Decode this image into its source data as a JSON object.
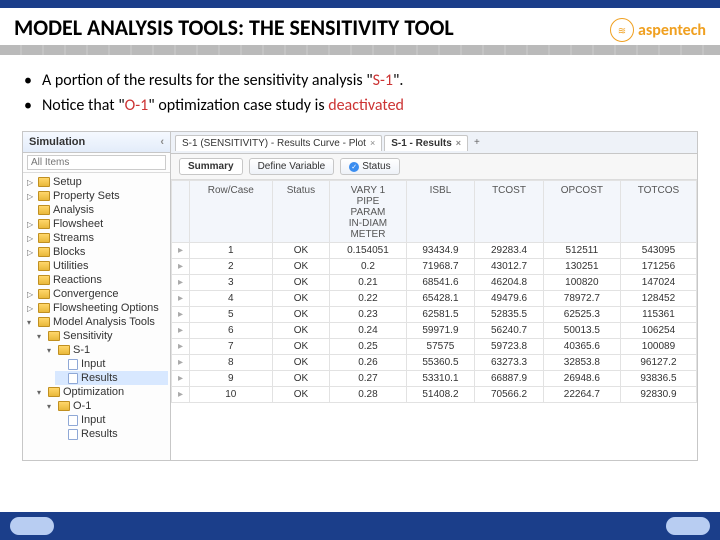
{
  "title": "MODEL ANALYSIS TOOLS: THE SENSITIVITY TOOL",
  "brand": "aspentech",
  "bullets": {
    "b1a": "A portion of the results for the sensitivity analysis \"",
    "b1b": "S-1",
    "b1c": "\".",
    "b2a": "Notice that \"",
    "b2b": "O-1",
    "b2c": "\" optimization case study is ",
    "b2d": "deactivated"
  },
  "sidebar": {
    "header": "Simulation",
    "search_placeholder": "All Items",
    "items": [
      {
        "label": "Setup",
        "tri": "▷",
        "cls": ""
      },
      {
        "label": "Property Sets",
        "tri": "▷",
        "cls": ""
      },
      {
        "label": "Analysis",
        "tri": "",
        "cls": ""
      },
      {
        "label": "Flowsheet",
        "tri": "▷",
        "cls": ""
      },
      {
        "label": "Streams",
        "tri": "▷",
        "cls": ""
      },
      {
        "label": "Blocks",
        "tri": "▷",
        "cls": ""
      },
      {
        "label": "Utilities",
        "tri": "",
        "cls": ""
      },
      {
        "label": "Reactions",
        "tri": "",
        "cls": ""
      },
      {
        "label": "Convergence",
        "tri": "▷",
        "cls": ""
      },
      {
        "label": "Flowsheeting Options",
        "tri": "▷",
        "cls": ""
      },
      {
        "label": "Model Analysis Tools",
        "tri": "▾",
        "cls": ""
      },
      {
        "label": "Sensitivity",
        "tri": "▾",
        "cls": "lvl1"
      },
      {
        "label": "S-1",
        "tri": "▾",
        "cls": "lvl2"
      },
      {
        "label": "Input",
        "tri": "",
        "cls": "lvl3",
        "leaf": true
      },
      {
        "label": "Results",
        "tri": "",
        "cls": "lvl3 selected",
        "leaf": true
      },
      {
        "label": "Optimization",
        "tri": "▾",
        "cls": "lvl1"
      },
      {
        "label": "O-1",
        "tri": "▾",
        "cls": "lvl2"
      },
      {
        "label": "Input",
        "tri": "",
        "cls": "lvl3",
        "leaf": true
      },
      {
        "label": "Results",
        "tri": "",
        "cls": "lvl3",
        "leaf": true
      }
    ]
  },
  "doctabs": {
    "t1": "S-1 (SENSITIVITY) - Results Curve - Plot",
    "t2": "S-1 - Results",
    "plus": "+"
  },
  "subtabs": {
    "t1": "Summary",
    "t2": "Define Variable",
    "t3": "Status"
  },
  "table": {
    "headers": [
      "Row/Case",
      "Status",
      "VARY 1\nPIPE\nPARAM\nIN-DIAM\nMETER",
      "ISBL",
      "TCOST",
      "OPCOST",
      "TOTCOS"
    ],
    "rows": [
      [
        "1",
        "OK",
        "0.154051",
        "93434.9",
        "29283.4",
        "512511",
        "543095"
      ],
      [
        "2",
        "OK",
        "0.2",
        "71968.7",
        "43012.7",
        "130251",
        "171256"
      ],
      [
        "3",
        "OK",
        "0.21",
        "68541.6",
        "46204.8",
        "100820",
        "147024"
      ],
      [
        "4",
        "OK",
        "0.22",
        "65428.1",
        "49479.6",
        "78972.7",
        "128452"
      ],
      [
        "5",
        "OK",
        "0.23",
        "62581.5",
        "52835.5",
        "62525.3",
        "115361"
      ],
      [
        "6",
        "OK",
        "0.24",
        "59971.9",
        "56240.7",
        "50013.5",
        "106254"
      ],
      [
        "7",
        "OK",
        "0.25",
        "57575",
        "59723.8",
        "40365.6",
        "100089"
      ],
      [
        "8",
        "OK",
        "0.26",
        "55360.5",
        "63273.3",
        "32853.8",
        "96127.2"
      ],
      [
        "9",
        "OK",
        "0.27",
        "53310.1",
        "66887.9",
        "26948.6",
        "93836.5"
      ],
      [
        "10",
        "OK",
        "0.28",
        "51408.2",
        "70566.2",
        "22264.7",
        "92830.9"
      ]
    ]
  }
}
